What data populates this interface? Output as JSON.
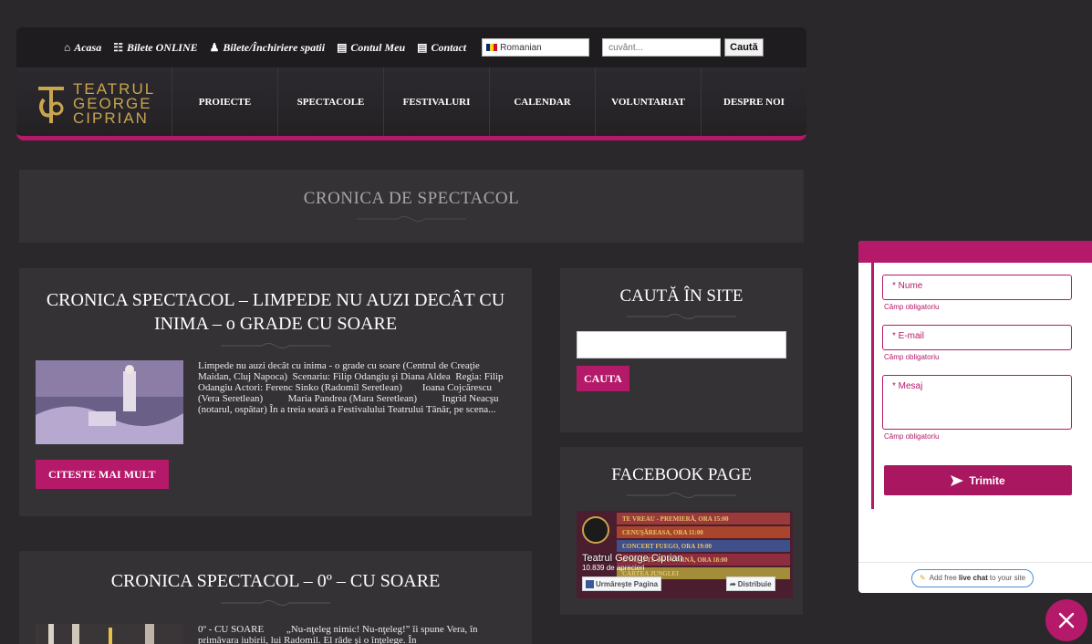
{
  "topbar": {
    "links": [
      {
        "icon": "home-icon",
        "glyph": "🏠",
        "label": "Acasa"
      },
      {
        "icon": "cart-icon",
        "glyph": "🛒",
        "label": "Bilete ONLINE"
      },
      {
        "icon": "users-icon",
        "glyph": "👥",
        "label": "Bilete/Închiriere spatii"
      },
      {
        "icon": "document-icon",
        "glyph": "📄",
        "label": "Contul Meu"
      },
      {
        "icon": "document-icon",
        "glyph": "📄",
        "label": "Contact"
      }
    ],
    "language": "Romanian",
    "search_placeholder": "cuvânt...",
    "search_button": "Caută"
  },
  "logo": {
    "line1": "TEATRUL",
    "line2": "GEORGE",
    "line3": "CIPRIAN"
  },
  "nav": [
    "PROIECTE",
    "SPECTACOLE",
    "FESTIVALURI",
    "CALENDAR",
    "VOLUNTARIAT",
    "DESPRE NOI"
  ],
  "page_title": "CRONICA DE SPECTACOL",
  "posts": [
    {
      "title": "CRONICA SPECTACOL – LIMPEDE NU AUZI DECÂT CU INIMA – o GRADE CU SOARE",
      "excerpt": "Limpede nu auzi decât cu inima - o grade cu soare (Centrul de Creaţie Maidan, Cluj Napoca)  Scenariu: Filip Odangiu şi Diana Aldea  Regia: Filip Odangiu Actori: Ferenc Sinko (Radomil Seretlean)        Ioana Cojcărescu (Vera Seretlean)          Maria Pandrea (Mara Seretlean)          Ingrid Neacşu (notarul, ospătar) În a treia seară a Festivalului Teatrului Tânăr, pe scena...",
      "readmore": "CITESTE MAI MULT"
    },
    {
      "title": "CRONICA SPECTACOL – 0º – CU SOARE",
      "excerpt": "0º - CU SOARE         „Nu-nţeleg nimic! Nu-nţeleg!” îi spune Vera, în primăvara iubirii, lui Radomil. El râde şi o înţelege. În"
    }
  ],
  "sidebar": {
    "search_title": "CAUTĂ ÎN SITE",
    "search_button": "CAUTA",
    "facebook_title": "FACEBOOK PAGE",
    "facebook": {
      "page_name": "Teatrul George Ciprian",
      "followers": "10.839 de aprecieri",
      "follow_button": "Urmăreşte Pagina",
      "share_button": "Distribuie",
      "posters": [
        "TE VREAU - PREMIERĂ, ORA 15:00",
        "CENUŞĂREASA, ORA 11:00",
        "CONCERT FUEGO, ORA 19:00",
        "O NOAPTE DE POMINĂ, ORA 18:00",
        "CARTEA JUNGLEI"
      ]
    }
  },
  "chat": {
    "name_label": "* Nume",
    "email_label": "* E-mail",
    "message_label": "* Mesaj",
    "required_hint": "Câmp obligatoriu",
    "send_button": "Trimite",
    "footer_pre": "Add free",
    "footer_bold": "live chat",
    "footer_post": "to your site"
  },
  "colors": {
    "accent": "#b5196a",
    "background": "#2b282c",
    "card": "#353236"
  }
}
